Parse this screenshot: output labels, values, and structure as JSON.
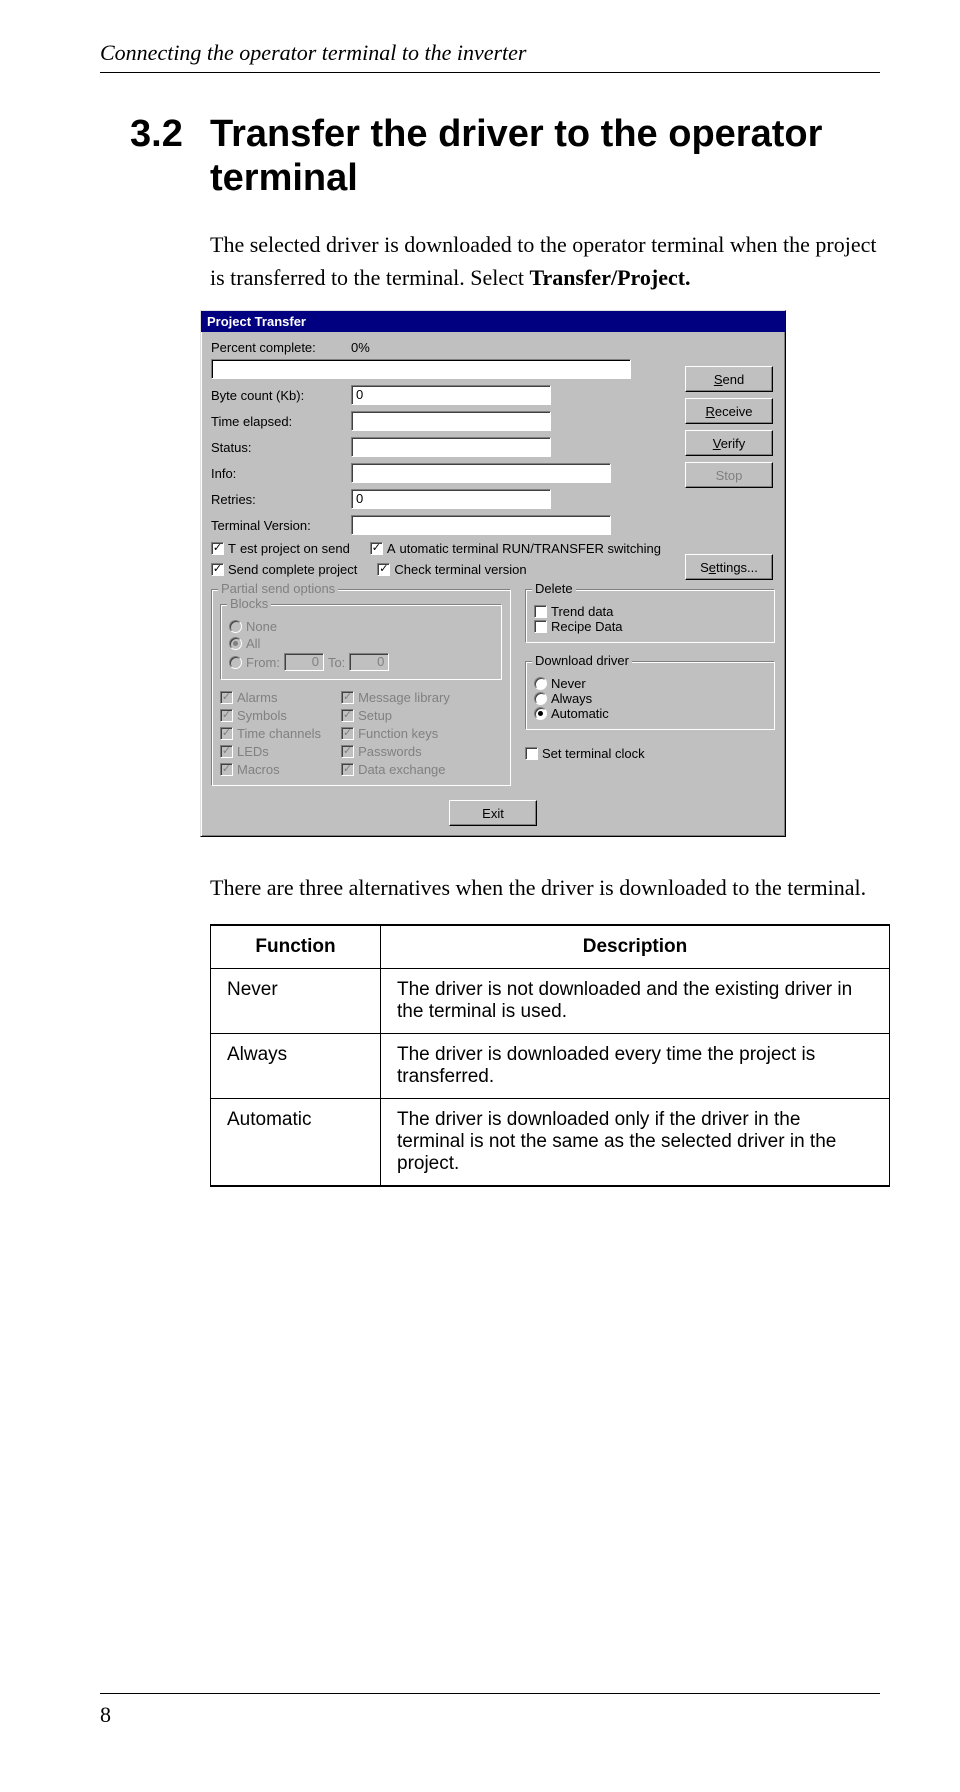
{
  "header": "Connecting the operator terminal to the inverter",
  "section": {
    "number": "3.2",
    "title": "Transfer the driver to the operator terminal"
  },
  "intro_a": "The selected driver is downloaded to the operator terminal when the project is transferred to the terminal. Select ",
  "intro_b": "Transfer/Project.",
  "dialog": {
    "title": "Project Transfer",
    "percent_label": "Percent complete:",
    "percent_value": "0%",
    "byte_label": "Byte count (Kb):",
    "byte_value": "0",
    "time_label": "Time elapsed:",
    "time_value": "",
    "status_label": "Status:",
    "status_value": "",
    "info_label": "Info:",
    "info_value": "",
    "retries_label": "Retries:",
    "retries_value": "0",
    "termver_label": "Terminal Version:",
    "termver_value": "",
    "buttons": {
      "send": "Send",
      "receive": "Receive",
      "verify": "Verify",
      "stop": "Stop",
      "settings": "Settings...",
      "exit": "Exit"
    },
    "chk_test": "Test project on send",
    "chk_auto": "Automatic terminal RUN/TRANSFER switching",
    "chk_sendcomp": "Send complete project",
    "chk_checkterm": "Check terminal version",
    "partial_legend": "Partial send options",
    "blocks_legend": "Blocks",
    "radio_none": "None",
    "radio_all": "All",
    "radio_from": "From:",
    "from_val": "0",
    "to_lbl": "To:",
    "to_val": "0",
    "leftcol": [
      "Alarms",
      "Symbols",
      "Time channels",
      "LEDs",
      "Macros"
    ],
    "rightcol": [
      "Message library",
      "Setup",
      "Function keys",
      "Passwords",
      "Data exchange"
    ],
    "delete_legend": "Delete",
    "del_trend": "Trend data",
    "del_recipe": "Recipe Data",
    "download_legend": "Download driver",
    "dl_never": "Never",
    "dl_always": "Always",
    "dl_auto": "Automatic",
    "set_clock": "Set terminal clock"
  },
  "after": "There are three alternatives when the driver is downloaded to the terminal.",
  "table": {
    "h1": "Function",
    "h2": "Description",
    "rows": [
      {
        "f": "Never",
        "d": "The driver is not downloaded and the existing driver in the terminal is used."
      },
      {
        "f": "Always",
        "d": "The driver is downloaded every time the project is transferred."
      },
      {
        "f": "Automatic",
        "d": "The driver is downloaded only if the driver in the terminal is not the same as the selected driver in the project."
      }
    ]
  },
  "page_number": "8"
}
